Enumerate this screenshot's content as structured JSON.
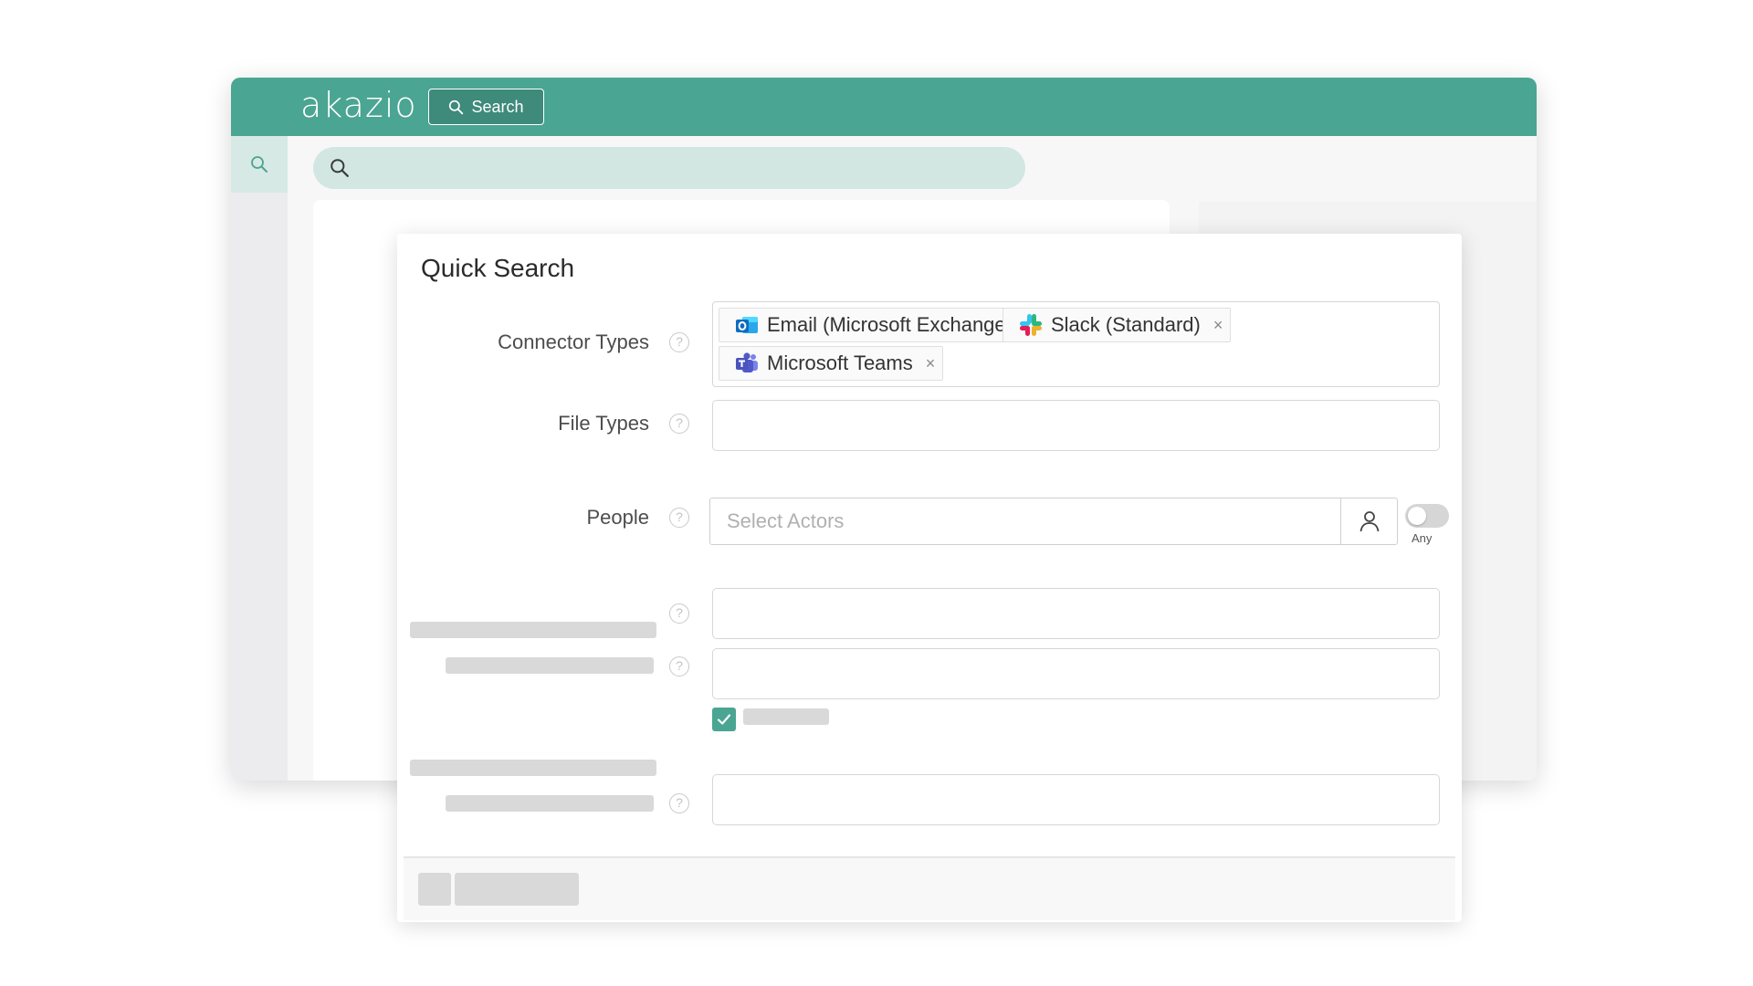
{
  "app": {
    "logo": "akazio",
    "search_button_label": "Search",
    "brand_color": "#4aa592"
  },
  "quick_search": {
    "title": "Quick Search",
    "help_glyph": "?",
    "connector_types": {
      "label": "Connector Types",
      "selected": [
        {
          "label": "Email (Microsoft Exchange)",
          "icon": "outlook-icon"
        },
        {
          "label": "Slack (Standard)",
          "icon": "slack-icon"
        },
        {
          "label": "Microsoft Teams",
          "icon": "teams-icon"
        }
      ],
      "remove_glyph": "×"
    },
    "file_types": {
      "label": "File Types",
      "value": ""
    },
    "people": {
      "label": "People",
      "placeholder": "Select Actors",
      "toggle_label": "Any",
      "toggle_on": false
    },
    "checkbox_checked": true
  }
}
